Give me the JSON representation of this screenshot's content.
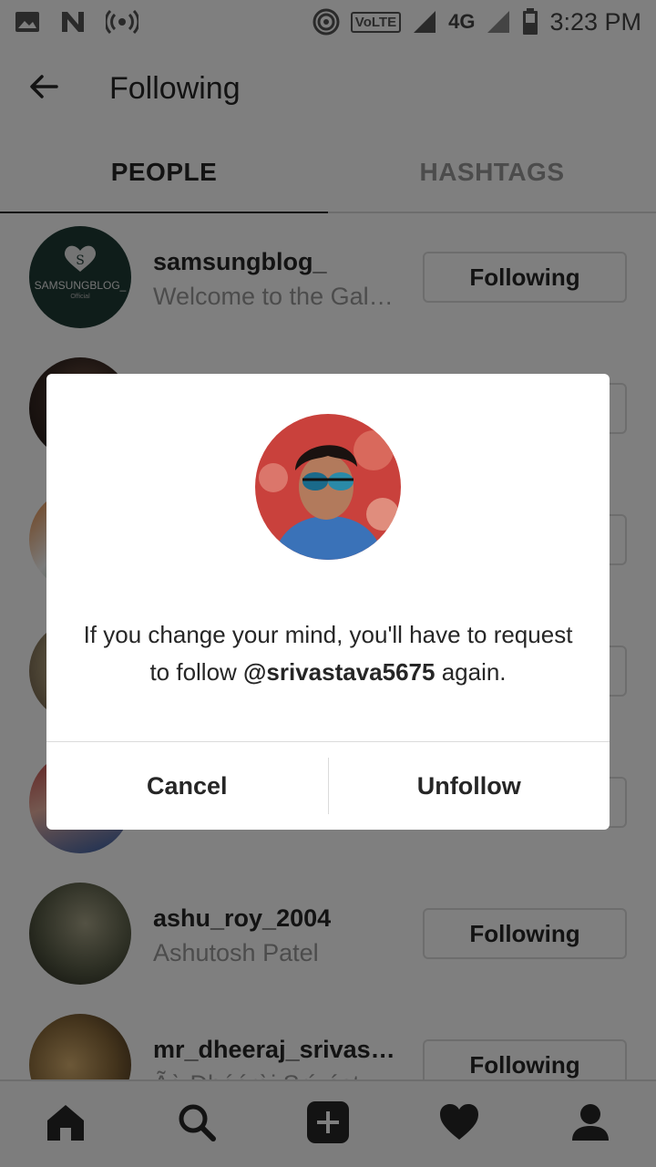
{
  "status_bar": {
    "time": "3:23 PM",
    "volte": "VoLTE",
    "network": "4G",
    "icons": [
      "image-icon",
      "n-icon",
      "broadcast-icon",
      "hotspot-icon",
      "signal-icon",
      "battery-icon"
    ]
  },
  "header": {
    "title": "Following",
    "back_icon": "arrow-left-icon"
  },
  "tabs": [
    {
      "label": "PEOPLE",
      "active": true
    },
    {
      "label": "HASHTAGS",
      "active": false
    }
  ],
  "list": {
    "rows": [
      {
        "username": "samsungblog_",
        "fullname": "Welcome to the Gal…",
        "button": "Following",
        "avatar_text": "SAMSUNGBLOG_",
        "avatar_sub": "Official",
        "avatar_color": "#1e3a34"
      },
      {
        "username": "",
        "fullname": "",
        "button": "",
        "avatar_color": "#3a2a24"
      },
      {
        "username": "",
        "fullname": "",
        "button": "",
        "avatar_color": "#d8884a"
      },
      {
        "username": "",
        "fullname": "",
        "button": "",
        "avatar_color": "#b8a78a"
      },
      {
        "username": "",
        "fullname": "",
        "button": "",
        "avatar_color": "#b13a3a"
      },
      {
        "username": "ashu_roy_2004",
        "fullname": "Ashutosh Patel",
        "button": "Following",
        "avatar_color": "#6b6f55"
      },
      {
        "username": "mr_dheeraj_srivasta…",
        "fullname": "Ãɑ̀ Dhéérɑ̀j Srívást…",
        "button": "Following",
        "avatar_color": "#8a6a3a"
      }
    ]
  },
  "dialog": {
    "message_before": "If you change your mind, you'll have to request to follow ",
    "handle": "@srivastava5675",
    "message_after": " again.",
    "cancel_label": "Cancel",
    "confirm_label": "Unfollow"
  },
  "bottom_nav": {
    "items": [
      "home-icon",
      "search-icon",
      "add-post-icon",
      "activity-heart-icon",
      "profile-icon"
    ]
  },
  "colors": {
    "text_primary": "#262626",
    "text_secondary": "#999999",
    "border": "#dbdbdb",
    "overlay": "rgba(0,0,0,0.5)"
  }
}
